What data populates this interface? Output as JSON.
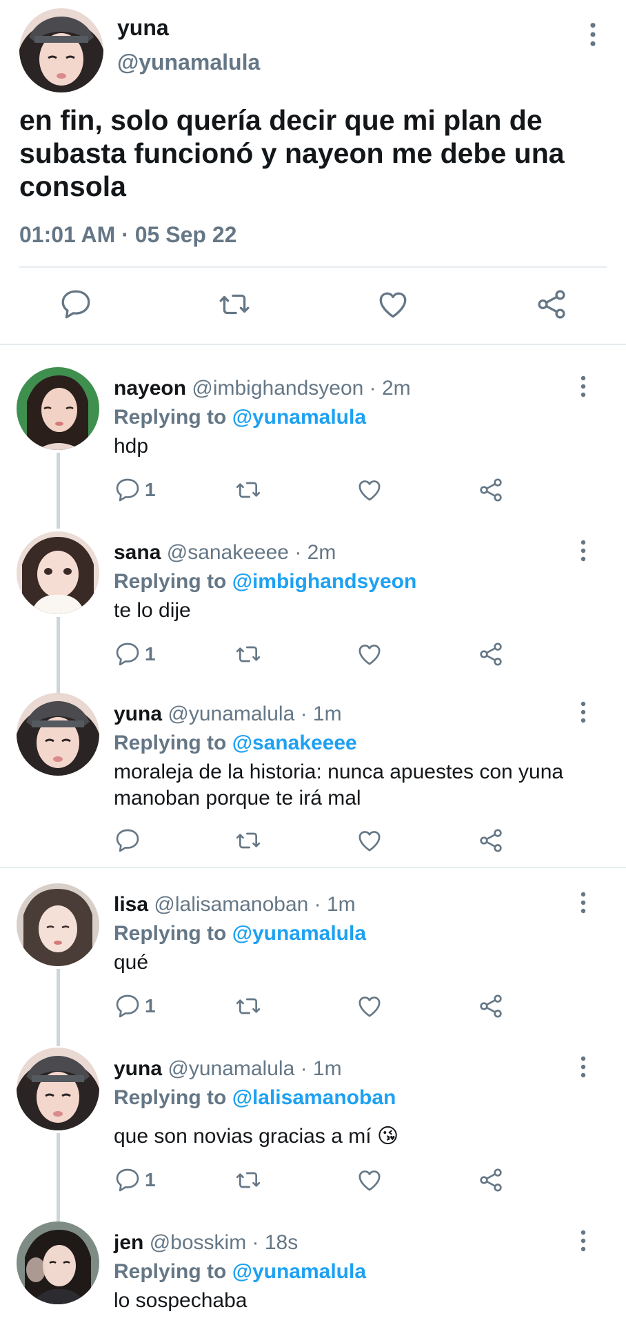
{
  "main_tweet": {
    "name": "yuna",
    "handle": "@yunamalula",
    "text": "en fin, solo quería decir que mi plan de subasta funcionó y nayeon me debe una consola",
    "timestamp": "01:01 AM · 05 Sep 22",
    "actions": [
      "reply-icon",
      "retweet-icon",
      "like-icon",
      "share-icon"
    ]
  },
  "replies": [
    {
      "name": "nayeon",
      "handle": "@imbighandsyeon",
      "time": "· 2m",
      "replying_prefix": "Replying to",
      "replying_to": "@yunamalula",
      "text": "hdp",
      "reply_count": "1"
    },
    {
      "name": "sana",
      "handle": "@sanakeeee",
      "time": "· 2m",
      "replying_prefix": "Replying to",
      "replying_to": "@imbighandsyeon",
      "text": "te lo dije",
      "reply_count": "1"
    },
    {
      "name": "yuna",
      "handle": "@yunamalula",
      "time": "· 1m",
      "replying_prefix": "Replying to",
      "replying_to": "@sanakeeee",
      "text": "moraleja de la historia: nunca apuestes con yuna manoban porque te irá mal",
      "reply_count": ""
    },
    {
      "name": "lisa",
      "handle": "@lalisamanoban",
      "time": "· 1m",
      "replying_prefix": "Replying to",
      "replying_to": "@yunamalula",
      "text": "qué",
      "reply_count": "1"
    },
    {
      "name": "yuna",
      "handle": "@yunamalula",
      "time": "· 1m",
      "replying_prefix": "Replying to",
      "replying_to": "@lalisamanoban",
      "text": "que son novias gracias a mí 😘",
      "reply_count": "1"
    },
    {
      "name": "jen",
      "handle": "@bosskim",
      "time": "· 18s",
      "replying_prefix": "Replying to",
      "replying_to": "@yunamalula",
      "text": "lo sospechaba",
      "reply_count": ""
    }
  ],
  "colors": {
    "link": "#1da1f2",
    "muted": "#657786",
    "text": "#14171a",
    "separator": "#e6ecf0"
  }
}
